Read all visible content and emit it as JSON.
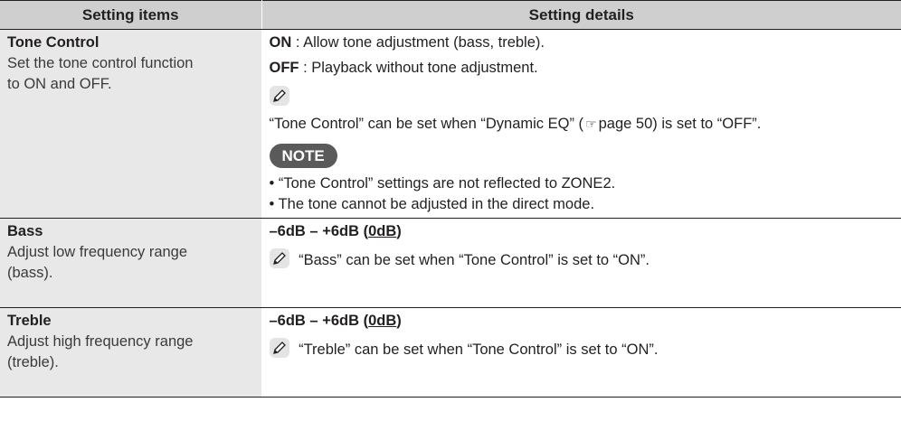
{
  "table": {
    "header": {
      "col1": "Setting items",
      "col2": "Setting details"
    },
    "rows": [
      {
        "title": "Tone Control",
        "desc_line1": "Set the tone control function",
        "desc_line2": "to ON and OFF.",
        "on_label": "ON",
        "on_text": " : Allow tone adjustment (bass, treble).",
        "off_label": "OFF",
        "off_text": " : Playback without tone adjustment.",
        "hint_before": "“Tone Control” can be set when “Dynamic EQ” (",
        "hint_ref_icon": "☞",
        "hint_after": "page 50) is set to “OFF”.",
        "note_label": "NOTE",
        "notes": [
          "• “Tone Control” settings are not reflected to ZONE2.",
          "• The tone cannot be adjusted in the direct mode."
        ]
      },
      {
        "title": "Bass",
        "desc_line1": "Adjust low frequency range",
        "desc_line2": "(bass).",
        "range_prefix": "–6dB – +6dB (",
        "range_default": "0dB",
        "range_suffix": ")",
        "hint": "“Bass” can be set when “Tone Control” is set to “ON”."
      },
      {
        "title": "Treble",
        "desc_line1": "Adjust high frequency range",
        "desc_line2": "(treble).",
        "range_prefix": "–6dB – +6dB (",
        "range_default": "0dB",
        "range_suffix": ")",
        "hint": "“Treble” can be set when “Tone Control” is set to “ON”."
      }
    ]
  },
  "icons": {
    "hint": "pencil-icon",
    "page_ref": "page-reference-icon"
  }
}
